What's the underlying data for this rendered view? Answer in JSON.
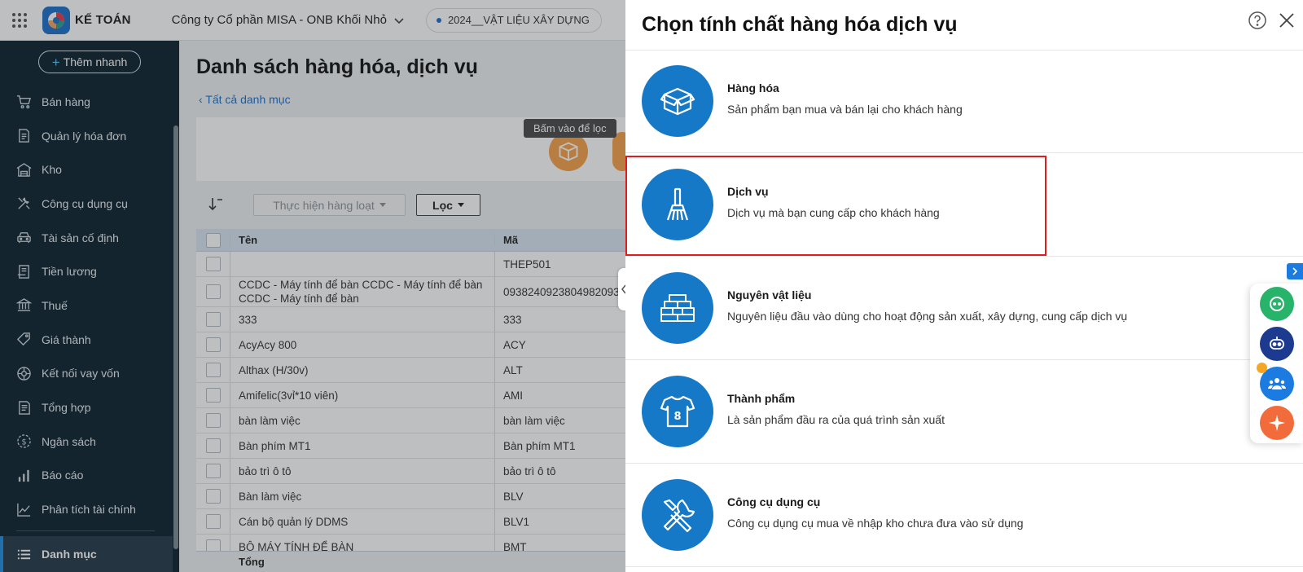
{
  "topbar": {
    "brand": "KẾ TOÁN",
    "company": "Công ty Cổ phần MISA - ONB Khối Nhỏ",
    "database": "2024__VẬT LIỆU XÂY DỰNG"
  },
  "sidebar": {
    "quick_add": "Thêm nhanh",
    "items": [
      {
        "label": "Bán hàng",
        "icon": "cart-icon"
      },
      {
        "label": "Quản lý hóa đơn",
        "icon": "invoice-icon"
      },
      {
        "label": "Kho",
        "icon": "warehouse-icon"
      },
      {
        "label": "Công cụ dụng cụ",
        "icon": "tools-icon"
      },
      {
        "label": "Tài sản cố định",
        "icon": "car-icon"
      },
      {
        "label": "Tiền lương",
        "icon": "salary-icon"
      },
      {
        "label": "Thuế",
        "icon": "bank-icon"
      },
      {
        "label": "Giá thành",
        "icon": "price-tag-icon"
      },
      {
        "label": "Kết nối vay vốn",
        "icon": "loan-icon"
      },
      {
        "label": "Tổng hợp",
        "icon": "summary-icon"
      },
      {
        "label": "Ngân sách",
        "icon": "budget-icon"
      },
      {
        "label": "Báo cáo",
        "icon": "bar-chart-icon"
      },
      {
        "label": "Phân tích tài chính",
        "icon": "line-chart-icon"
      }
    ],
    "active_item": "Danh mục"
  },
  "main": {
    "title": "Danh sách hàng hóa, dịch vụ",
    "back_link": "Tất cả danh mục",
    "tooltip": "Bấm vào để lọc",
    "bulk_action": "Thực hiện hàng loạt",
    "filter": "Lọc",
    "columns": {
      "name": "Tên",
      "code": "Mã"
    },
    "rows": [
      {
        "name": "",
        "code": "THEP501"
      },
      {
        "name": "CCDC - Máy tính để bàn CCDC - Máy tính để bàn CCDC - Máy tính để bàn",
        "code": "0938240923804982093"
      },
      {
        "name": "333",
        "code": "333"
      },
      {
        "name": "AcyAcy 800",
        "code": "ACY"
      },
      {
        "name": "Althax (H/30v)",
        "code": "ALT"
      },
      {
        "name": "Amifelic(3vỉ*10 viên)",
        "code": "AMI"
      },
      {
        "name": "bàn làm việc",
        "code": "bàn làm việc"
      },
      {
        "name": "Bàn phím MT1",
        "code": "Bàn phím MT1"
      },
      {
        "name": "bảo trì ô tô",
        "code": "bảo trì ô tô"
      },
      {
        "name": "Bàn làm việc",
        "code": "BLV"
      },
      {
        "name": "Cán bộ quản lý DDMS",
        "code": "BLV1"
      },
      {
        "name": "BỘ MÁY TÍNH ĐỂ BÀN",
        "code": "BMT"
      }
    ],
    "footer": "Tổng"
  },
  "drawer": {
    "title": "Chọn tính chất hàng hóa dịch vụ",
    "options": [
      {
        "title": "Hàng hóa",
        "desc": "Sản phẩm bạn mua và bán lại cho khách hàng",
        "icon": "box-icon"
      },
      {
        "title": "Dịch vụ",
        "desc": "Dịch vụ mà bạn cung cấp cho khách hàng",
        "icon": "broom-icon"
      },
      {
        "title": "Nguyên vật liệu",
        "desc": "Nguyên liệu đầu vào dùng cho hoạt động sản xuất, xây dựng, cung cấp dịch vụ",
        "icon": "bricks-icon"
      },
      {
        "title": "Thành phẩm",
        "desc": "Là sản phẩm đầu ra của quá trình sản xuất",
        "icon": "shirt-icon"
      },
      {
        "title": "Công cụ dụng cụ",
        "desc": "Công cụ dụng cụ mua về nhập kho chưa đưa vào sử dụng",
        "icon": "wrench-screwdriver-icon"
      }
    ],
    "highlighted_option": "Dịch vụ"
  },
  "colors": {
    "sidebar_bg": "#0c2230",
    "accent": "#1679c8",
    "highlight_border": "#e01d1d",
    "orange": "#f6a24a"
  }
}
